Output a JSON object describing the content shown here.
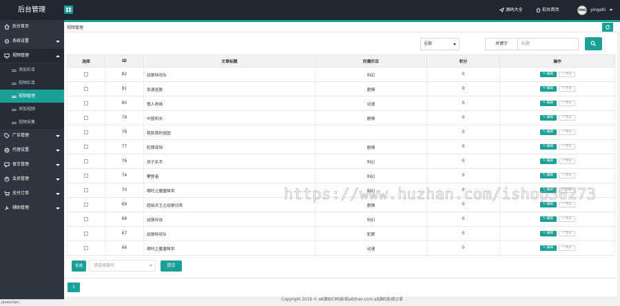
{
  "app": {
    "title": "后台管理"
  },
  "header": {
    "links": [
      {
        "icon": "send-icon",
        "label": "源码大全"
      },
      {
        "icon": "home-icon",
        "label": "前台首页"
      }
    ],
    "user": {
      "avatar_text": "YINGSHI",
      "name": "yingshi"
    }
  },
  "sidebar": {
    "items": [
      {
        "icon": "home-icon",
        "label": "后台首页"
      },
      {
        "icon": "gear-icon",
        "label": "系统设置"
      },
      {
        "icon": "monitor-icon",
        "label": "视频管理"
      },
      {
        "icon": "tag-icon",
        "label": "广告管理"
      },
      {
        "icon": "globe-icon",
        "label": "代理设置"
      },
      {
        "icon": "comment-icon",
        "label": "留言管理"
      },
      {
        "icon": "user-icon",
        "label": "会员管理"
      },
      {
        "icon": "cart-icon",
        "label": "支付订单"
      },
      {
        "icon": "tool-icon",
        "label": "辅助管理"
      }
    ],
    "video_sub": [
      "添加栏目",
      "视频栏目",
      "视频管理",
      "添加视频",
      "视频采集"
    ]
  },
  "breadcrumb": "视频管理",
  "filters": {
    "category_value": "全部",
    "keyword_label": "关键字",
    "keyword_placeholder": "标题"
  },
  "table": {
    "headers": [
      "选择",
      "ID",
      "文章标题",
      "所属栏目",
      "积分",
      "操作"
    ],
    "edit_label": "编辑",
    "preview_label": "预览",
    "rows": [
      {
        "id": "82",
        "title": "战狼特攻队",
        "category": "科幻",
        "points": "0"
      },
      {
        "id": "81",
        "title": "急速逃脱",
        "category": "剧情",
        "points": "0"
      },
      {
        "id": "80",
        "title": "雪人奇缘",
        "category": "动漫",
        "points": "0"
      },
      {
        "id": "79",
        "title": "中国机长",
        "category": "剧情",
        "points": "0"
      },
      {
        "id": "78",
        "title": "我和我的祖国",
        "category": "",
        "points": "0"
      },
      {
        "id": "77",
        "title": "犯罪现场",
        "category": "剧情",
        "points": "0"
      },
      {
        "id": "76",
        "title": "双子杀手",
        "category": "科幻",
        "points": "0"
      },
      {
        "id": "74",
        "title": "攀登者",
        "category": "科幻",
        "points": "0"
      },
      {
        "id": "70",
        "title": "哪吒之魔童降世",
        "category": "科幻",
        "points": "0"
      },
      {
        "id": "69",
        "title": "超级兵王之战狼归来",
        "category": "剧情",
        "points": "0"
      },
      {
        "id": "68",
        "title": "战狼传说",
        "category": "科幻",
        "points": "0"
      },
      {
        "id": "67",
        "title": "战狼特攻队",
        "category": "犯罪",
        "points": "0"
      },
      {
        "id": "66",
        "title": "哪吒之魔童降世",
        "category": "动漫",
        "points": "0"
      }
    ]
  },
  "bulk": {
    "all_label": "全选",
    "op_placeholder": "请选择操作",
    "submit_label": "提交"
  },
  "pagination": {
    "current": "1"
  },
  "footer": "Copyright 2019 © a8源码CMS影视a8zhan.com a8源码影视分享",
  "status_bar": "javascript:;",
  "watermark": "https://www.huzhan.com/ishop30273",
  "colors": {
    "accent": "#1aa094",
    "topbar": "#1f2733",
    "sidebar": "#2e3540"
  }
}
